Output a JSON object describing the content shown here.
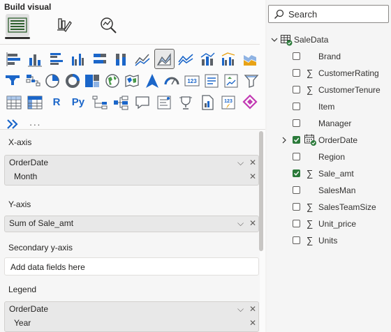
{
  "build_visual": {
    "title": "Build visual",
    "modes": [
      {
        "name": "build-visual-tab",
        "icon": "build-visual-icon"
      },
      {
        "name": "format-visual-tab",
        "icon": "format-brush-icon"
      },
      {
        "name": "analytics-tab",
        "icon": "analytics-magnifier-icon"
      }
    ],
    "visual_types": [
      [
        "stacked-bar-chart",
        "stacked-column-chart",
        "clustered-bar-chart",
        "clustered-column-chart",
        "100-stacked-bar-chart",
        "100-stacked-column-chart",
        "line-chart",
        "area-chart",
        "stacked-area-chart",
        "line-and-stacked-column-chart",
        "line-and-clustered-column-chart",
        "ribbon-chart"
      ],
      [
        "waterfall-chart",
        "scatter-chart",
        "pie-chart",
        "donut-chart",
        "treemap",
        "map",
        "filled-map",
        "azure-map",
        "gauge",
        "card",
        "multi-row-card",
        "kpi",
        "slicer"
      ],
      [
        "table",
        "matrix",
        "r-visual",
        "python-visual",
        "key-influencers",
        "decomposition-tree",
        "qna",
        "smart-narrative",
        "goals",
        "paginated-report",
        "power-apps",
        "power-automate"
      ],
      [
        "get-more-visuals",
        "more-options"
      ]
    ],
    "r_label": "R",
    "py_label": "Py",
    "more_label": "···",
    "selected_visual": "area-chart"
  },
  "wells": {
    "x_axis": {
      "label": "X-axis",
      "field": "OrderDate",
      "sub": "Month"
    },
    "y_axis": {
      "label": "Y-axis",
      "field": "Sum of Sale_amt"
    },
    "secondary_y": {
      "label": "Secondary y-axis",
      "placeholder": "Add data fields here"
    },
    "legend": {
      "label": "Legend",
      "field": "OrderDate",
      "sub": "Year"
    }
  },
  "data_pane": {
    "search_placeholder": "Search",
    "table_name": "SaleData",
    "fields": [
      {
        "name": "Brand",
        "sigma": false,
        "checked": false
      },
      {
        "name": "CustomerRating",
        "sigma": true,
        "checked": false
      },
      {
        "name": "CustomerTenure",
        "sigma": true,
        "checked": false
      },
      {
        "name": "Item",
        "sigma": false,
        "checked": false
      },
      {
        "name": "Manager",
        "sigma": false,
        "checked": false
      },
      {
        "name": "OrderDate",
        "sigma": false,
        "checked": true,
        "hierarchy": true
      },
      {
        "name": "Region",
        "sigma": false,
        "checked": false
      },
      {
        "name": "Sale_amt",
        "sigma": true,
        "checked": true
      },
      {
        "name": "SalesMan",
        "sigma": false,
        "checked": false
      },
      {
        "name": "SalesTeamSize",
        "sigma": true,
        "checked": false
      },
      {
        "name": "Unit_price",
        "sigma": true,
        "checked": false
      },
      {
        "name": "Units",
        "sigma": true,
        "checked": false
      }
    ]
  },
  "colors": {
    "accent": "#118dff",
    "checked": "#2b7a3a",
    "icon_blue": "#1b66c9"
  }
}
